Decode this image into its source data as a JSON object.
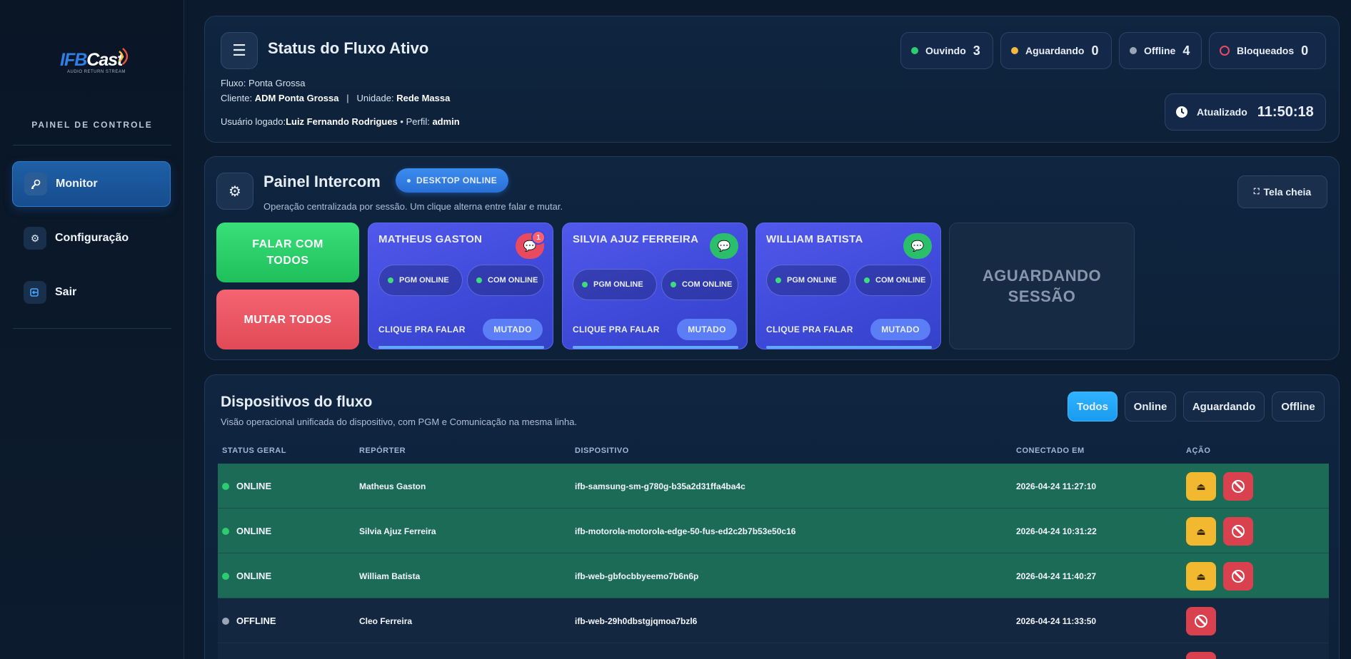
{
  "sidebar": {
    "logo": {
      "brand_a": "IFB",
      "brand_b": "Cast",
      "tagline": "AUDIO RETURN STREAM"
    },
    "panel_label": "PAINEL DE CONTROLE",
    "items": [
      {
        "label": "Monitor",
        "icon": "satellite-icon",
        "active": true
      },
      {
        "label": "Configuração",
        "icon": "gear-icon",
        "active": false
      },
      {
        "label": "Sair",
        "icon": "logout-icon",
        "active": false
      }
    ]
  },
  "status": {
    "title": "Status do Fluxo Ativo",
    "fluxo_label": "Fluxo:",
    "fluxo_value": "Ponta Grossa",
    "cliente_label": "Cliente:",
    "cliente_value": "ADM Ponta Grossa",
    "separator": "|",
    "unidade_label": "Unidade:",
    "unidade_value": "Rede Massa",
    "usuario_label": "Usuário logado:",
    "usuario_value": "Luiz Fernando Rodrigues",
    "perfil_label": "• Perfil:",
    "perfil_value": "admin",
    "counters": [
      {
        "label": "Ouvindo",
        "value": "3",
        "color": "#2ecc71"
      },
      {
        "label": "Aguardando",
        "value": "0",
        "color": "#f5b942"
      },
      {
        "label": "Offline",
        "value": "4",
        "color": "#9aa6b6"
      },
      {
        "label": "Bloqueados",
        "value": "0",
        "color": "#e84b5f"
      }
    ],
    "updated_label": "Atualizado",
    "updated_time": "11:50:18"
  },
  "intercom": {
    "title": "Painel Intercom",
    "badge": "DESKTOP ONLINE",
    "subtitle": "Operação centralizada por sessão. Um clique alterna entre falar e mutar.",
    "fullscreen_label": "Tela cheia",
    "talk_all": "FALAR COM TODOS",
    "mute_all": "MUTAR TODOS",
    "reporters": [
      {
        "name": "MATHEUS GASTON",
        "pgm": "PGM ONLINE",
        "com": "COM ONLINE",
        "click": "CLIQUE PRA FALAR",
        "state": "MUTADO",
        "chat": "red",
        "unread": "1"
      },
      {
        "name": "SILVIA AJUZ FERREIRA",
        "pgm": "PGM ONLINE",
        "com": "COM ONLINE",
        "click": "CLIQUE PRA FALAR",
        "state": "MUTADO",
        "chat": "green",
        "unread": ""
      },
      {
        "name": "WILLIAM BATISTA",
        "pgm": "PGM ONLINE",
        "com": "COM ONLINE",
        "click": "CLIQUE PRA FALAR",
        "state": "MUTADO",
        "chat": "green",
        "unread": ""
      }
    ],
    "waiting": "AGUARDANDO SESSÃO"
  },
  "devices": {
    "title": "Dispositivos do fluxo",
    "subtitle": "Visão operacional unificada do dispositivo, com PGM e Comunicação na mesma linha.",
    "filters": [
      "Todos",
      "Online",
      "Aguardando",
      "Offline"
    ],
    "active_filter": "Todos",
    "columns": [
      "STATUS GERAL",
      "REPÓRTER",
      "DISPOSITIVO",
      "CONECTADO EM",
      "AÇÃO"
    ],
    "rows": [
      {
        "status": "ONLINE",
        "reporter": "Matheus Gaston",
        "device": "ifb-samsung-sm-g780g-b35a2d31ffa4ba4c",
        "connected": "2026-04-24 11:27:10"
      },
      {
        "status": "ONLINE",
        "reporter": "Silvia Ajuz Ferreira",
        "device": "ifb-motorola-motorola-edge-50-fus-ed2c2b7b53e50c16",
        "connected": "2026-04-24 10:31:22"
      },
      {
        "status": "ONLINE",
        "reporter": "William Batista",
        "device": "ifb-web-gbfocbbyeemo7b6n6p",
        "connected": "2026-04-24 11:40:27"
      },
      {
        "status": "OFFLINE",
        "reporter": "Cleo Ferreira",
        "device": "ifb-web-29h0dbstgjqmoa7bzl6",
        "connected": "2026-04-24 11:33:50"
      }
    ]
  },
  "colors": {
    "online_row": "#1c6b57",
    "accent": "#1a9bf0",
    "online_dot": "#2ecc71",
    "offline_dot": "#9aa6b6"
  }
}
